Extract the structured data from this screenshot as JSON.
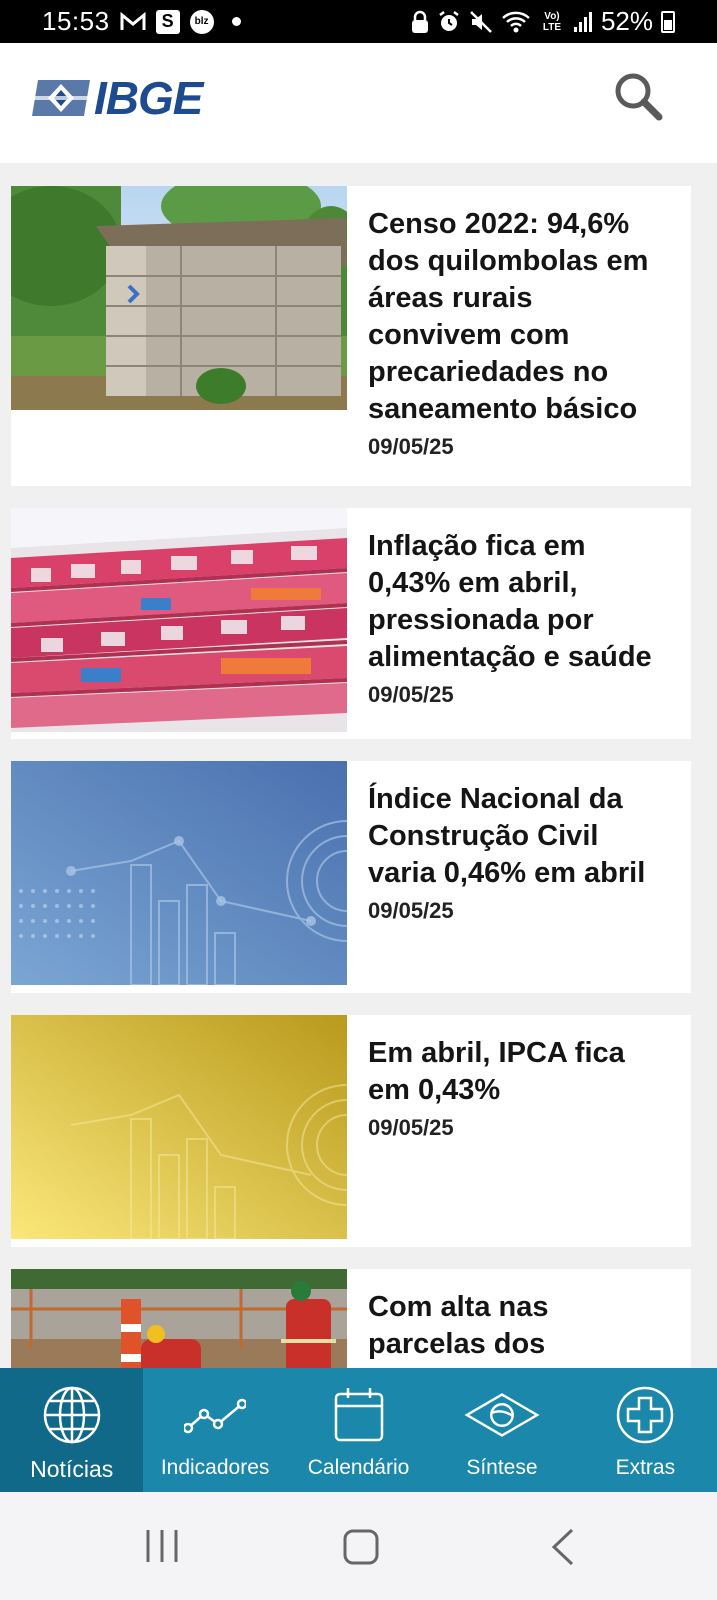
{
  "status_bar": {
    "time": "15:53",
    "notification_icons": [
      "gmail-icon",
      "s-app-icon",
      "blz-icon",
      "dot-icon"
    ],
    "s_label": "S",
    "blz_label": "blz",
    "system_icons": [
      "lock-icon",
      "alarm-icon",
      "mute-icon",
      "wifi-icon",
      "volte-icon",
      "signal-icon",
      "battery-icon"
    ],
    "volte_label": "Vo) LTE",
    "battery": "52%"
  },
  "header": {
    "logo_text": "IBGE",
    "brand_color": "#1e4b8f",
    "search_icon": "search-icon"
  },
  "news": [
    {
      "title": "Censo 2022: 94,6% dos quilombolas em áreas rurais convivem com precariedades no saneamento básico",
      "date": "09/05/25",
      "image": "wooden-outhouse-photo"
    },
    {
      "title": "Inflação fica em 0,43% em abril, pressionada por alimentação e saúde",
      "date": "09/05/25",
      "image": "pharmacy-shelves-photo"
    },
    {
      "title": "Índice Nacional da Construção Civil varia 0,46% em abril",
      "date": "09/05/25",
      "image": "blue-chart-graphic"
    },
    {
      "title": "Em abril, IPCA fica em 0,43%",
      "date": "09/05/25",
      "image": "yellow-chart-graphic"
    },
    {
      "title": "Com alta nas parcelas dos",
      "date": "",
      "image": "construction-workers-photo"
    }
  ],
  "bottom_nav": {
    "color": "#1a87ab",
    "active_color": "#11698a",
    "items": [
      {
        "label": "Notícias",
        "icon": "globe-icon",
        "active": true
      },
      {
        "label": "Indicadores",
        "icon": "line-chart-icon",
        "active": false
      },
      {
        "label": "Calendário",
        "icon": "calendar-icon",
        "active": false
      },
      {
        "label": "Síntese",
        "icon": "brazil-flag-icon",
        "active": false
      },
      {
        "label": "Extras",
        "icon": "plus-circle-icon",
        "active": false
      }
    ]
  },
  "system_nav": {
    "icons": [
      "recents-icon",
      "home-icon",
      "back-icon"
    ]
  }
}
